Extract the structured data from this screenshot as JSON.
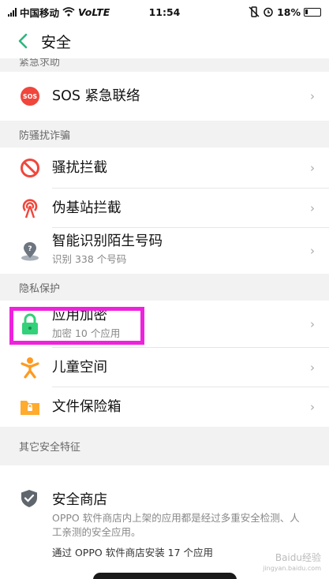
{
  "status_bar": {
    "carrier": "中国移动",
    "network": "VoLTE",
    "time": "11:54",
    "battery": "18%"
  },
  "nav": {
    "title": "安全"
  },
  "partial_section_header": "紧急求助",
  "sections": {
    "anti_harass": "防骚扰诈骗",
    "privacy": "隐私保护",
    "other": "其它安全特征"
  },
  "items": {
    "sos": {
      "title": "SOS 紧急联络",
      "icon_text": "SOS"
    },
    "harass_block": {
      "title": "骚扰拦截"
    },
    "pseudo_base": {
      "title": "伪基站拦截"
    },
    "smart_identify": {
      "title": "智能识别陌生号码",
      "subtitle": "识别 338 个号码"
    },
    "app_encrypt": {
      "title": "应用加密",
      "subtitle": "加密 10 个应用"
    },
    "kids_space": {
      "title": "儿童空间"
    },
    "file_safe": {
      "title": "文件保险箱"
    }
  },
  "store": {
    "title": "安全商店",
    "description": "OPPO 软件商店内上架的应用都是经过多重安全检测、人工亲测的安全应用。",
    "count_text": "通过 OPPO 软件商店安装 17 个应用"
  },
  "watermark": {
    "line1": "Baidu经验",
    "line2": "jingyan.baidu.com"
  },
  "chevron": "›",
  "colors": {
    "accent": "#2cb67d",
    "highlight": "#ee22dd",
    "sos_red": "#f0463c",
    "lock_green": "#33d17a",
    "kids_orange": "#ff9a1f",
    "folder_orange": "#ffab2e"
  }
}
